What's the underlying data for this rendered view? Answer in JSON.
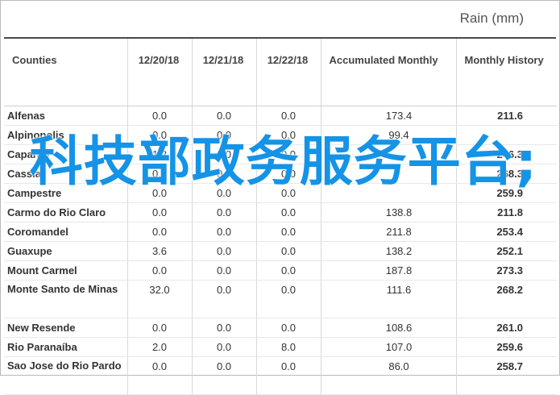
{
  "title": "Rain (mm)",
  "columns": [
    "Counties",
    "12/20/18",
    "12/21/18",
    "12/22/18",
    "Accumulated Monthly",
    "Monthly History"
  ],
  "rows": [
    {
      "county": "Alfenas",
      "d1": "0.0",
      "d2": "0.0",
      "d3": "0.0",
      "acc": "173.4",
      "hist": "211.6"
    },
    {
      "county": "Alpinopolis",
      "d1": "0.0",
      "d2": "0.0",
      "d3": "0.0",
      "acc": "99.4",
      "hist": ""
    },
    {
      "county": "Caparaó",
      "d1": "1.2",
      "d2": "0.0",
      "d3": "0.0",
      "acc": "",
      "hist": "246.3"
    },
    {
      "county": "Cassia",
      "d1": "0.0",
      "d2": "0.0",
      "d3": "0.0",
      "acc": "",
      "hist": "268.3"
    },
    {
      "county": "Campestre",
      "d1": "0.0",
      "d2": "0.0",
      "d3": "0.0",
      "acc": "",
      "hist": "259.9"
    },
    {
      "county": "Carmo do Rio Claro",
      "d1": "0.0",
      "d2": "0.0",
      "d3": "0.0",
      "acc": "138.8",
      "hist": "211.8"
    },
    {
      "county": "Coromandel",
      "d1": "0.0",
      "d2": "0.0",
      "d3": "0.0",
      "acc": "211.8",
      "hist": "253.4"
    },
    {
      "county": "Guaxupe",
      "d1": "3.6",
      "d2": "0.0",
      "d3": "0.0",
      "acc": "138.2",
      "hist": "252.1"
    },
    {
      "county": "Mount Carmel",
      "d1": "0.0",
      "d2": "0.0",
      "d3": "0.0",
      "acc": "187.8",
      "hist": "273.3"
    },
    {
      "county": "Monte Santo de Minas",
      "d1": "32.0",
      "d2": "0.0",
      "d3": "0.0",
      "acc": "111.6",
      "hist": "268.2"
    },
    {
      "county": "New Resende",
      "d1": "0.0",
      "d2": "0.0",
      "d3": "0.0",
      "acc": "108.6",
      "hist": "261.0"
    },
    {
      "county": "Rio Paranaíba",
      "d1": "2.0",
      "d2": "0.0",
      "d3": "8.0",
      "acc": "107.0",
      "hist": "259.6"
    },
    {
      "county": "Sao Jose do Rio Pardo",
      "d1": "0.0",
      "d2": "0.0",
      "d3": "0.0",
      "acc": "86.0",
      "hist": "258.7"
    }
  ],
  "watermark": "科技部政务服务平台;"
}
